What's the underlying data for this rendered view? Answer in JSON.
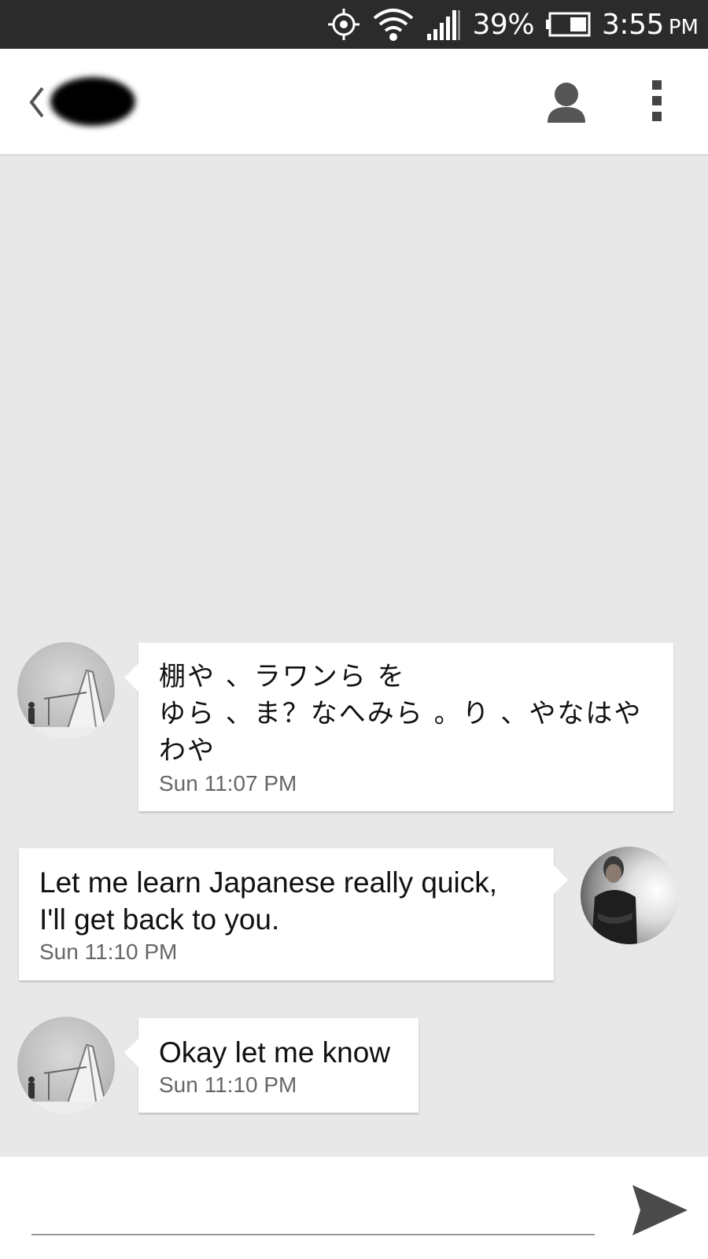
{
  "status_bar": {
    "icons": [
      "gps-icon",
      "wifi-icon",
      "signal-icon",
      "battery-icon"
    ],
    "battery": "39%",
    "time": "3:55",
    "ampm": "PM"
  },
  "app_bar": {
    "back_icon": "chevron-left-icon",
    "contact_icon": "person-icon",
    "menu_icon": "overflow-menu-icon"
  },
  "messages": [
    {
      "direction": "incoming",
      "lines": [
        "棚や 、ラワンら を",
        "ゆら 、ま？なへみら 。り 、やなはや",
        "わや"
      ],
      "time": "Sun  11:07 PM"
    },
    {
      "direction": "outgoing",
      "lines": [
        "Let me learn Japanese really quick,",
        "I'll get back to you."
      ],
      "time": "Sun  11:10 PM"
    },
    {
      "direction": "incoming",
      "lines": [
        "Okay let me know"
      ],
      "time": "Sun  11:10 PM"
    }
  ],
  "composer": {
    "placeholder": "",
    "value": "",
    "send_icon": "send-icon"
  },
  "colors": {
    "status_bar": "#2b2b2b",
    "chat_background": "#e8e8e8",
    "bubble": "#ffffff"
  }
}
